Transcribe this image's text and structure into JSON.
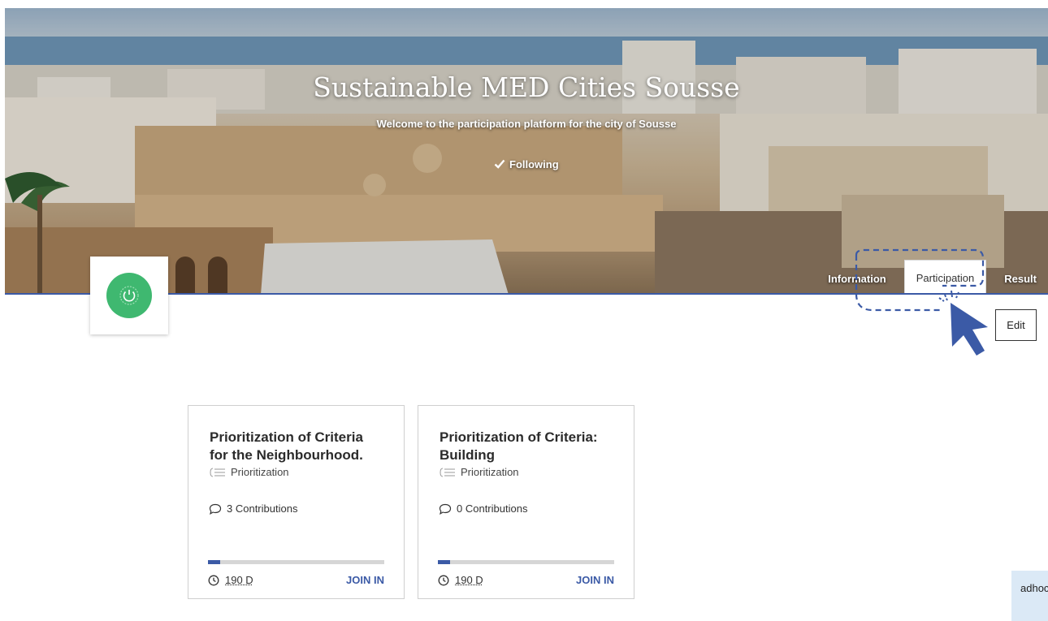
{
  "hero": {
    "title": "Sustainable MED Cities Sousse",
    "subtitle": "Welcome to the participation platform for the city of Sousse",
    "follow_label": "Following"
  },
  "tabs": [
    {
      "label": "Information",
      "active": false
    },
    {
      "label": "Participation",
      "active": true
    },
    {
      "label": "Result",
      "active": false
    }
  ],
  "logo": {
    "icon": "power-icon",
    "color": "#3fb870"
  },
  "edit_label": "Edit",
  "cards": [
    {
      "title": "Prioritization of Criteria for the Neighbourhood.",
      "type": "Prioritization",
      "contributions": "3 Contributions",
      "progress": 0.07,
      "time": "190 D",
      "action": "JOIN IN"
    },
    {
      "title": "Prioritization of Criteria: Building",
      "type": "Prioritization",
      "contributions": "0 Contributions",
      "progress": 0.07,
      "time": "190 D",
      "action": "JOIN IN"
    }
  ],
  "chat_label": "adhoc",
  "accent_color": "#3b5aa6"
}
